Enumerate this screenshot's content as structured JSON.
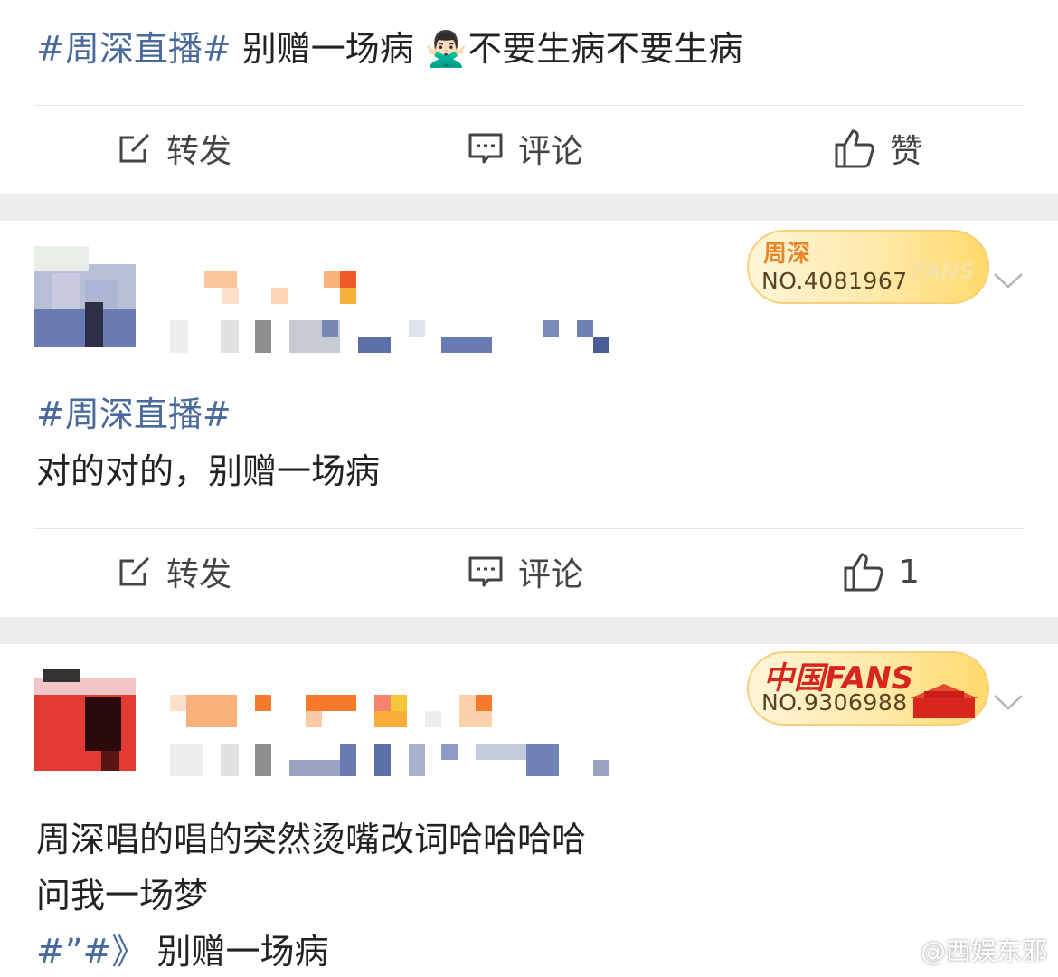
{
  "post1": {
    "topic": "#周深直播#",
    "text_before": " 别赠一场病",
    "emoji": "🙅🏻‍♂️",
    "text_after": "不要生病不要生病"
  },
  "actions": {
    "repost_label": "转发",
    "comment_label": "评论",
    "like_label": "赞",
    "like_count_2": "1"
  },
  "comment1": {
    "badge_title": "周深",
    "badge_number": "NO.4081967",
    "badge_fans": "FANS",
    "topic": "#周深直播#",
    "text": "对的对的，别赠一场病"
  },
  "comment2": {
    "badge_title": "中国FANS",
    "badge_number": "NO.9306988",
    "line1": "周深唱的唱的突然烫嘴改词哈哈哈哈",
    "line2": "问我一场梦",
    "topic": "#”#》",
    "line3_rest": " 别赠一场病"
  },
  "watermark": "@西娱东邪",
  "colors": {
    "topic_blue": "#4a6a9c",
    "separator_gray": "#ededed",
    "badge_gold": "#ffd96a"
  }
}
